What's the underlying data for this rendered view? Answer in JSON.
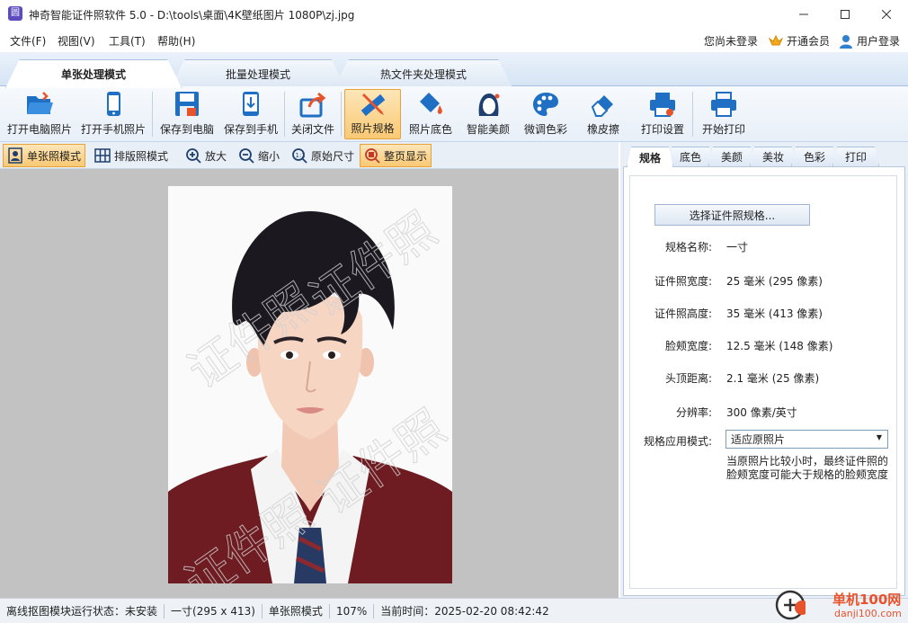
{
  "window": {
    "title": "神奇智能证件照软件 5.0 - D:\\tools\\桌面\\4K壁纸图片 1080P\\zj.jpg",
    "app_icon_glyph": "圆",
    "controls": [
      "minimize-icon",
      "maximize-icon",
      "close-icon"
    ]
  },
  "menu": {
    "items": [
      "文件(F)",
      "视图(V)",
      "工具(T)",
      "帮助(H)"
    ],
    "login_status": "您尚未登录",
    "vip_label": "开通会员",
    "user_login_label": "用户登录"
  },
  "mode_tabs": [
    {
      "label": "单张处理模式",
      "active": true
    },
    {
      "label": "批量处理模式",
      "active": false
    },
    {
      "label": "热文件夹处理模式",
      "active": false
    }
  ],
  "toolbar": [
    {
      "label": "打开电脑照片",
      "icon": "folder-open-icon"
    },
    {
      "label": "打开手机照片",
      "icon": "phone-icon"
    },
    {
      "label": "保存到电脑",
      "icon": "save-icon"
    },
    {
      "label": "保存到手机",
      "icon": "save-to-phone-icon"
    },
    {
      "label": "关闭文件",
      "icon": "close-file-icon"
    },
    {
      "label": "照片规格",
      "icon": "ruler-pencil-icon",
      "active": true
    },
    {
      "label": "照片底色",
      "icon": "paint-bucket-icon"
    },
    {
      "label": "智能美颜",
      "icon": "beauty-face-icon"
    },
    {
      "label": "微调色彩",
      "icon": "palette-icon"
    },
    {
      "label": "橡皮擦",
      "icon": "eraser-icon"
    },
    {
      "label": "打印设置",
      "icon": "print-settings-icon"
    },
    {
      "label": "开始打印",
      "icon": "printer-icon"
    }
  ],
  "viewbar": [
    {
      "label": "单张照模式",
      "icon": "single-photo-icon",
      "active": true
    },
    {
      "label": "排版照模式",
      "icon": "grid-layout-icon"
    },
    {
      "label": "放大",
      "icon": "zoom-in-icon"
    },
    {
      "label": "缩小",
      "icon": "zoom-out-icon"
    },
    {
      "label": "原始尺寸",
      "icon": "original-size-icon"
    },
    {
      "label": "整页显示",
      "icon": "fit-page-icon",
      "active": true
    }
  ],
  "photo": {
    "watermark": "证件照"
  },
  "right_tabs": [
    {
      "label": "规格",
      "active": true
    },
    {
      "label": "底色"
    },
    {
      "label": "美颜"
    },
    {
      "label": "美妆"
    },
    {
      "label": "色彩"
    },
    {
      "label": "打印"
    }
  ],
  "spec": {
    "select_button": "选择证件照规格...",
    "rows": [
      {
        "label": "规格名称:",
        "value": "一寸"
      },
      {
        "label": "证件照宽度:",
        "value": "25 毫米 (295 像素)"
      },
      {
        "label": "证件照高度:",
        "value": "35 毫米 (413 像素)"
      },
      {
        "label": "脸颊宽度:",
        "value": "12.5 毫米 (148 像素)"
      },
      {
        "label": "头顶距离:",
        "value": "2.1 毫米 (25 像素)"
      },
      {
        "label": "分辨率:",
        "value": "300 像素/英寸"
      }
    ],
    "mode_label": "规格应用模式:",
    "mode_value": "适应原照片",
    "note_line1": "当原照片比较小时，最终证件照的",
    "note_line2": "脸颊宽度可能大于规格的脸颊宽度"
  },
  "status": {
    "module": "离线抠图模块运行状态：未安装",
    "size": "一寸(295 x 413)",
    "mode": "单张照模式",
    "zoom": "107%",
    "time": "当前时间：2025-02-20 08:42:42"
  },
  "watermark_site": {
    "text": "单机100网",
    "url": "danji100.com"
  },
  "colors": {
    "accent": "#1f6fc5",
    "active_tool": "#f9c974",
    "canvas_bg": "#c2c2c2",
    "sweater": "#6e1c22"
  }
}
